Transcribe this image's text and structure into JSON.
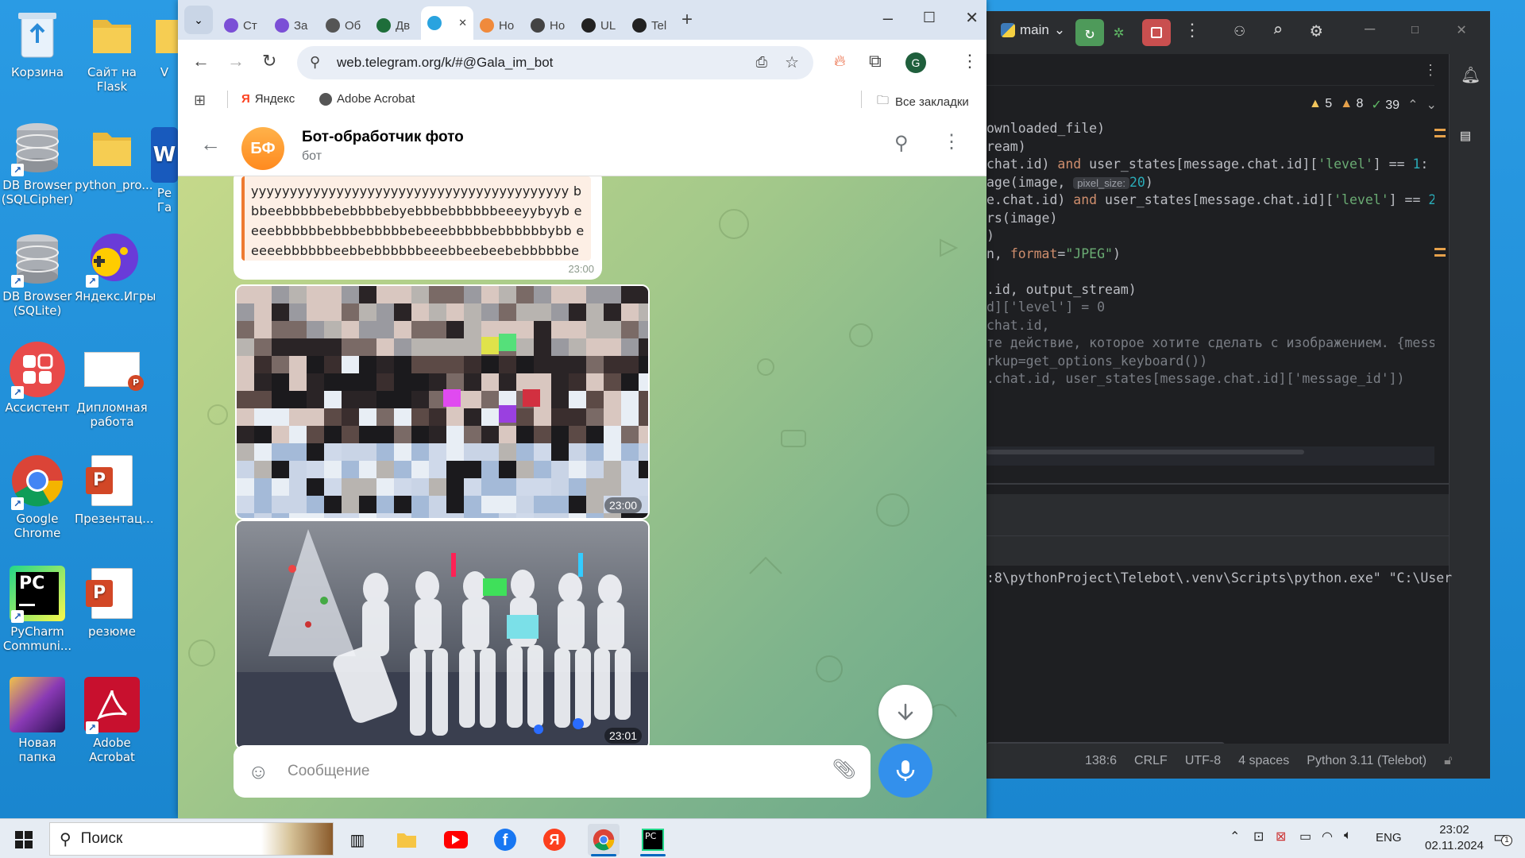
{
  "desktop": {
    "icons": [
      {
        "label": "Корзина"
      },
      {
        "label": "Сайт на Flask"
      },
      {
        "label": "V"
      },
      {
        "label": "DB Browser (SQLCipher)"
      },
      {
        "label": "python_pro..."
      },
      {
        "label": "Ре Га"
      },
      {
        "label": "DB Browser (SQLite)"
      },
      {
        "label": "Яндекс.Игры"
      },
      {
        "label": "Ассистент"
      },
      {
        "label": "Дипломная работа"
      },
      {
        "label": "Google Chrome"
      },
      {
        "label": "Презентац..."
      },
      {
        "label": "PyCharm Communi..."
      },
      {
        "label": "резюме"
      },
      {
        "label": "Новая папка"
      },
      {
        "label": "Adobe Acrobat"
      }
    ]
  },
  "ide": {
    "branch": "main",
    "inspections": {
      "warnings": "5",
      "weak": "8",
      "ok": "39"
    },
    "code": [
      {
        "a": "ownloaded_file)"
      },
      {
        "a": "ream)"
      },
      {
        "a": "chat.id) ",
        "k": "and",
        "b": " user_states[message.chat.id][",
        "s": "'level'",
        "c": "] == ",
        "n": "1",
        "d": ":"
      },
      {
        "a": "age(image, ",
        "hint": "pixel_size:",
        "n": "20",
        "d": ")"
      },
      {
        "a": "e.chat.id) ",
        "k": "and",
        "b": " user_states[message.chat.id][",
        "s": "'level'",
        "c": "] == ",
        "n": "2",
        "d": ":"
      },
      {
        "a": "rs(image)"
      },
      {
        "a": ")"
      },
      {
        "a": "n, ",
        "k": "format",
        "b": "=",
        "s": "\"JPEG\"",
        "c": ")"
      },
      {
        "a": ""
      },
      {
        "a": ".id, output_stream)"
      },
      {
        "a": "d]['level'] = 0",
        "muted": true
      },
      {
        "a": "chat.id,",
        "muted": true
      },
      {
        "a": "те действие, которое хотите сделать с изображением. {messag",
        "muted": true
      },
      {
        "a": "rkup=get_options_keyboard())",
        "muted": true
      },
      {
        "a": ".chat.id, user_states[message.chat.id]['message_id'])",
        "muted": true
      }
    ],
    "run_line": ":8\\pythonProject\\Telebot\\.venv\\Scripts\\python.exe\" \"C:\\User",
    "status": {
      "position": "138:6",
      "line_sep": "CRLF",
      "encoding": "UTF-8",
      "indent": "4 spaces",
      "interpreter": "Python 3.11 (Telebot)"
    }
  },
  "browser": {
    "tabs": [
      {
        "label": "Ст",
        "color": "#7b4fd6"
      },
      {
        "label": "За",
        "color": "#7b4fd6"
      },
      {
        "label": "Об",
        "color": "#555555"
      },
      {
        "label": "Дв",
        "color": "#1e6e3a"
      },
      {
        "label": "",
        "color": "#2aa3df",
        "active": true
      },
      {
        "label": "Но",
        "color": "#f08a3c"
      },
      {
        "label": "Но",
        "color": "#444444"
      },
      {
        "label": "UL",
        "color": "#222222"
      },
      {
        "label": "Tel",
        "color": "#222222"
      }
    ],
    "url": "web.telegram.org/k/#@Gala_im_bot",
    "profile_initial": "G",
    "bookmarks": {
      "yandex": "Яндекс",
      "acrobat": "Adobe Acrobat",
      "all": "Все закладки"
    }
  },
  "telegram": {
    "avatar_initials": "БФ",
    "chat_title": "Бот-обработчик фото",
    "chat_subtitle": "бот",
    "quote_text": "yyyyyyyyyyyyyyyyyyyyyyyyyyyyyyyyyyyyyyyyy bbbeebbbbbebebbbbebyebbbebbbbbbeeeyybyyb eeeebbbbbbebbbebbbbbebeeebbbbbebbbbbbybb eeeeebbbbbbeebbebbbbbbeeebbeebeebebbbbbbe eeeeeeeeeeeebbebbebbbebebeeebeeeebbeeeee",
    "quote_time": "23:00",
    "photo1_time": "23:00",
    "photo2_time": "23:01",
    "input_placeholder": "Сообщение"
  },
  "taskbar": {
    "search_label": "Поиск",
    "lang": "ENG",
    "time": "23:02",
    "date": "02.11.2024",
    "notif_count": "1"
  },
  "colors": {
    "telegram_blue": "#3390ec",
    "quote_accent": "#ee7a30",
    "desktop_bg": "#1f8fd8"
  }
}
